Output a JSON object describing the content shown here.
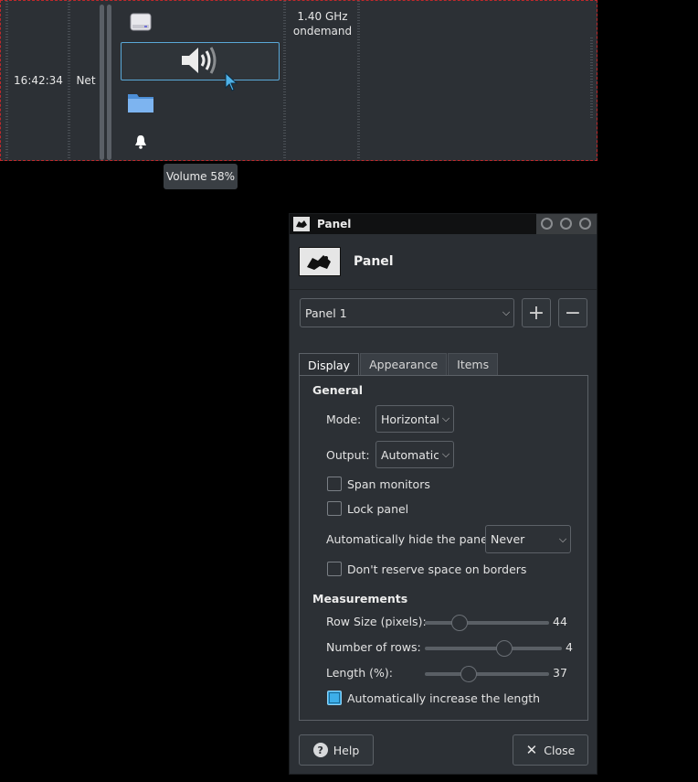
{
  "panel": {
    "clock": "16:42:34",
    "net_label": "Net",
    "cpu_freq": "1.40 GHz",
    "cpu_governor": "ondemand",
    "icons": [
      "drive-icon",
      "volume-icon",
      "folder-icon",
      "bell-icon"
    ]
  },
  "tooltip": {
    "text": "Volume 58%"
  },
  "dialog": {
    "window_title": "Panel",
    "header_title": "Panel",
    "panel_select": "Panel 1",
    "add_icon": "plus-icon",
    "remove_icon": "minus-icon",
    "tabs": [
      "Display",
      "Appearance",
      "Items"
    ],
    "active_tab": "Display",
    "general": {
      "heading": "General",
      "mode_label": "Mode:",
      "mode_value": "Horizontal",
      "output_label": "Output:",
      "output_value": "Automatic",
      "span_monitors": {
        "label": "Span monitors",
        "checked": false
      },
      "lock_panel": {
        "label": "Lock panel",
        "checked": false
      },
      "autohide_label": "Automatically hide the panel:",
      "autohide_value": "Never",
      "reserve_space": {
        "label": "Don't reserve space on borders",
        "checked": false
      }
    },
    "measurements": {
      "heading": "Measurements",
      "row_size": {
        "label": "Row Size (pixels):",
        "value": "44",
        "fraction": 0.28
      },
      "rows": {
        "label": "Number of rows:",
        "value": "4",
        "fraction": 0.58
      },
      "length": {
        "label": "Length (%):",
        "value": "37",
        "fraction": 0.35
      },
      "auto_length": {
        "label": "Automatically increase the length",
        "checked": true
      }
    },
    "help_label": "Help",
    "close_label": "Close"
  },
  "colors": {
    "accent": "#3daee9",
    "panel_bg": "#2c3035",
    "debug_border": "#c0282b"
  }
}
